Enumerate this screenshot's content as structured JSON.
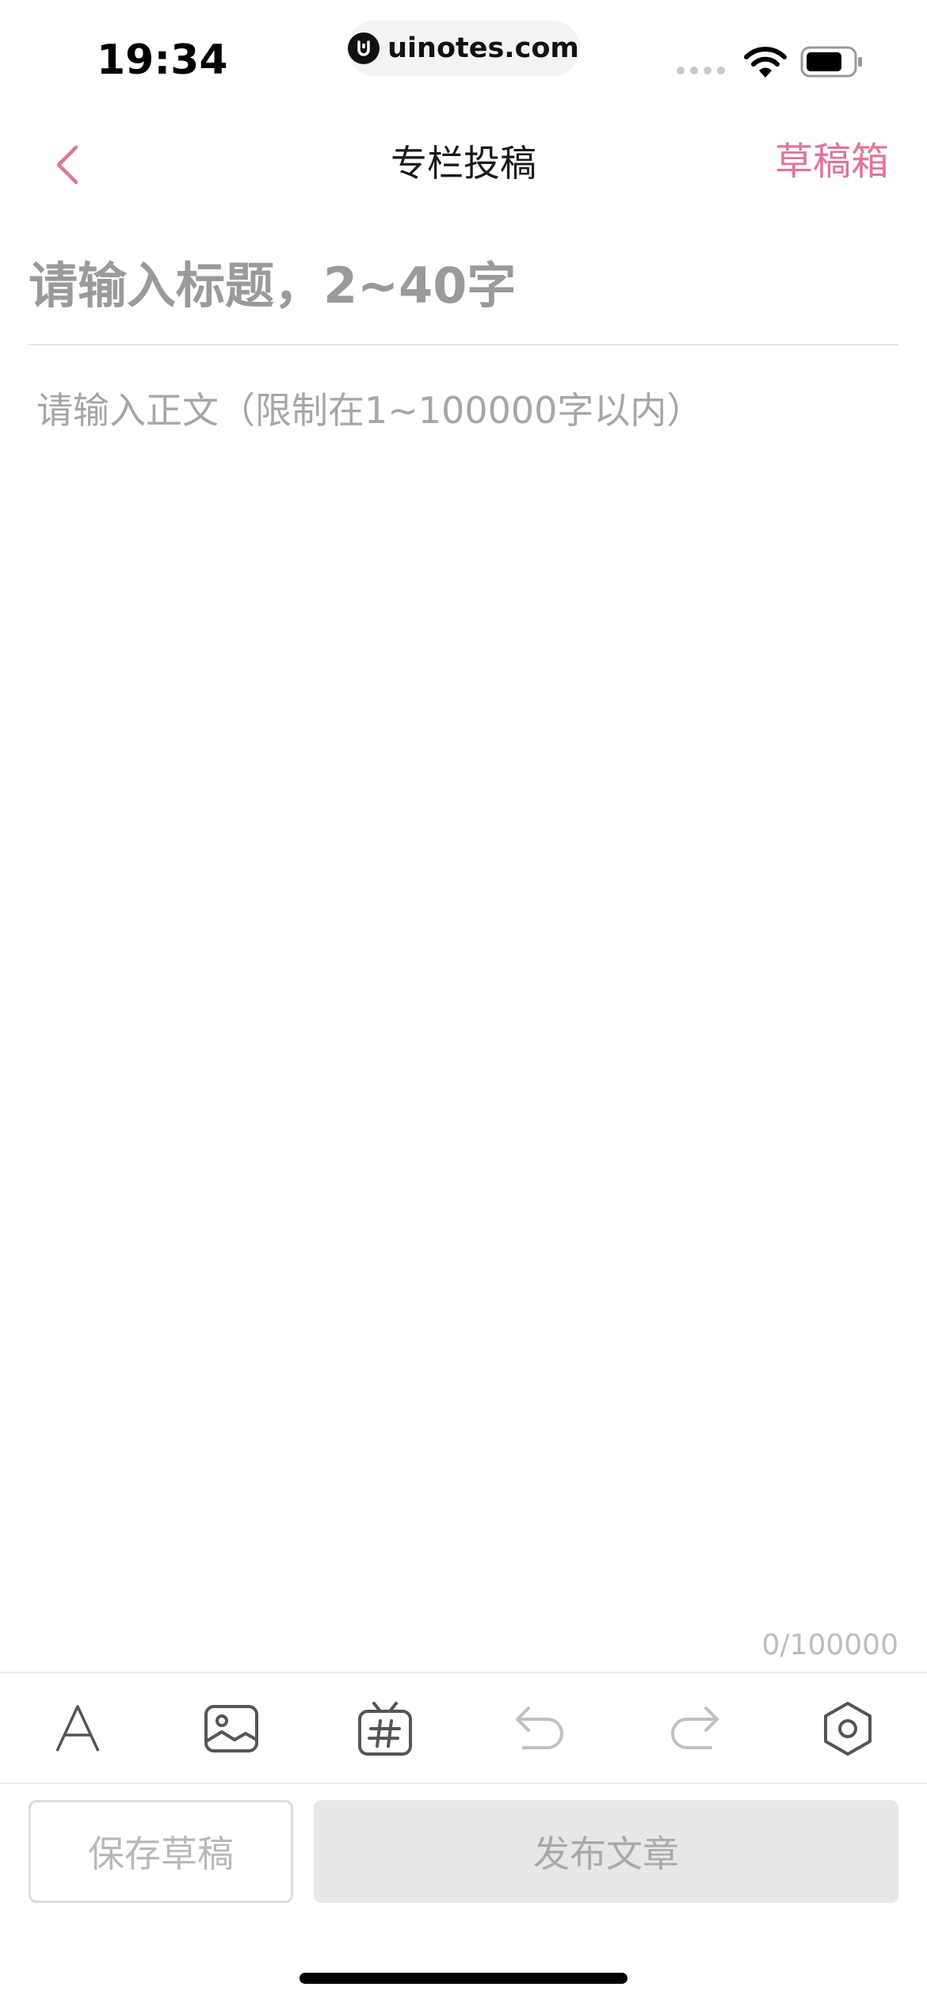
{
  "status_bar": {
    "time": "19:34",
    "url": "uinotes.com",
    "icons": [
      "signal-icon",
      "wifi-icon",
      "battery-icon"
    ]
  },
  "nav": {
    "title": "专栏投稿",
    "drafts_label": "草稿箱",
    "back_icon": "chevron-left-icon"
  },
  "editor": {
    "title_placeholder": "请输入标题，2~40字",
    "title_value": "",
    "body_placeholder": "请输入正文（限制在1~100000字以内）",
    "body_value": "",
    "char_count": "0/100000"
  },
  "toolbar": {
    "tools": [
      {
        "name": "text-format",
        "icon": "text-format-icon"
      },
      {
        "name": "image",
        "icon": "image-icon"
      },
      {
        "name": "topic",
        "icon": "tv-hashtag-icon"
      },
      {
        "name": "undo",
        "icon": "undo-icon"
      },
      {
        "name": "redo",
        "icon": "redo-icon"
      },
      {
        "name": "settings",
        "icon": "hexagon-settings-icon"
      }
    ]
  },
  "actions": {
    "save_draft": "保存草稿",
    "publish": "发布文章"
  },
  "colors": {
    "accent": "#e0759a",
    "disabled_text": "#a9a9a9",
    "publish_bg": "#e6e7e9"
  }
}
